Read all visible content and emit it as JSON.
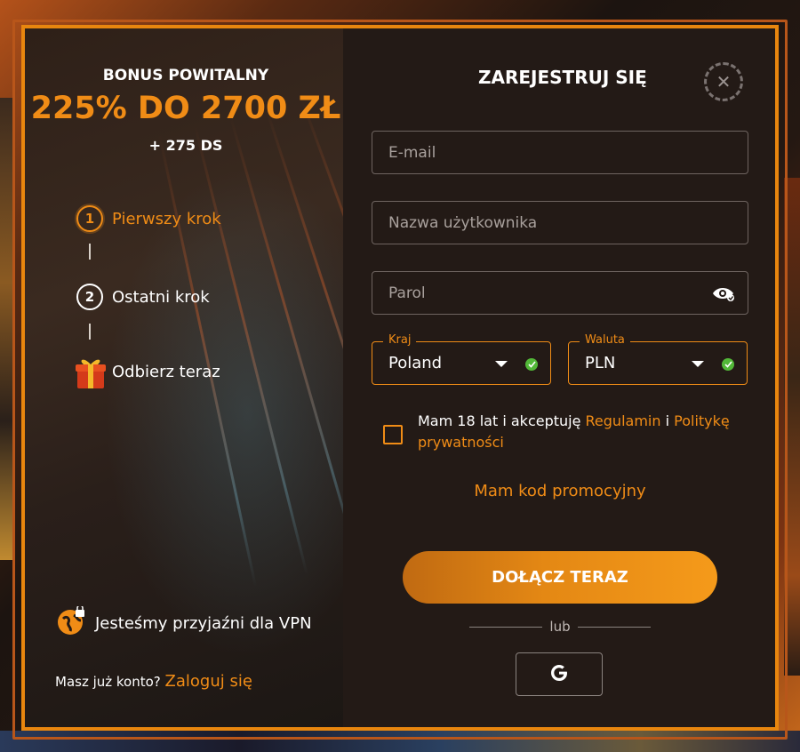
{
  "bonus": {
    "title": "BONUS POWITALNY",
    "amount": "225% DO 2700 ZŁ",
    "extra": "+ 275 DS"
  },
  "steps": [
    {
      "number": "1",
      "label": "Pierwszy krok"
    },
    {
      "number": "2",
      "label": "Ostatni krok"
    },
    {
      "label": "Odbierz teraz"
    }
  ],
  "vpn": {
    "text": "Jesteśmy przyjaźni dla VPN"
  },
  "login": {
    "question": "Masz już konto?",
    "link": "Zaloguj się"
  },
  "form": {
    "title": "ZAREJESTRUJ SIĘ",
    "email_placeholder": "E-mail",
    "username_placeholder": "Nazwa użytkownika",
    "password_placeholder": "Parol",
    "country": {
      "legend": "Kraj",
      "value": "Poland"
    },
    "currency": {
      "legend": "Waluta",
      "value": "PLN"
    },
    "terms": {
      "prefix": "Mam 18 lat i akceptuję ",
      "link1": "Regulamin",
      "middle": " i ",
      "link2": "Politykę prywatności"
    },
    "promo": "Mam kod promocyjny",
    "join_button": "DOŁĄCZ TERAZ",
    "or": "lub"
  },
  "colors": {
    "accent": "#f08c16",
    "success": "#52b838",
    "panel": "#231a16"
  }
}
